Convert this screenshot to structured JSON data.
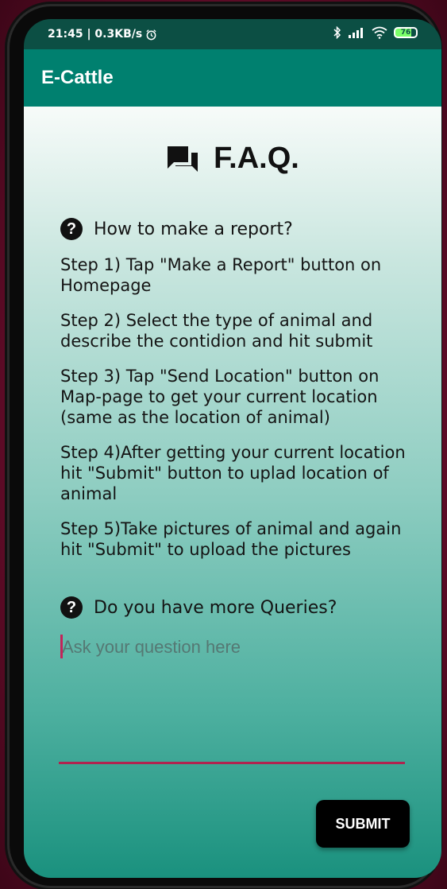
{
  "status_bar": {
    "time_speed": "21:45 | 0.3KB/s",
    "alarm_icon": "alarm-icon",
    "bluetooth_icon": "bluetooth-icon",
    "signal_icon": "signal-icon",
    "wifi_icon": "wifi-icon",
    "battery_level": "76"
  },
  "app_bar": {
    "title": "E-Cattle"
  },
  "faq": {
    "icon": "forum-icon",
    "title": "F.A.Q.",
    "question_1": "How to make a report?",
    "steps": [
      "Step 1) Tap \"Make a Report\" button on Homepage",
      "Step 2) Select the type of animal and describe the contidion and hit submit",
      "Step 3) Tap \"Send Location\" button on Map-page to get your current location (same as the location of animal)",
      "Step 4)After getting your current location hit \"Submit\" button to uplad location of animal",
      "Step 5)Take pictures of animal and again hit \"Submit\" to upload the pictures"
    ],
    "question_2": "Do you have more Queries?",
    "question_glyph": "?"
  },
  "query_form": {
    "input_value": "",
    "input_placeholder": "Ask your question here",
    "submit_label": "SUBMIT"
  },
  "colors": {
    "app_bar": "#00806f",
    "status_bar": "#0c4f44",
    "accent": "#b0234f",
    "button": "#000000"
  }
}
